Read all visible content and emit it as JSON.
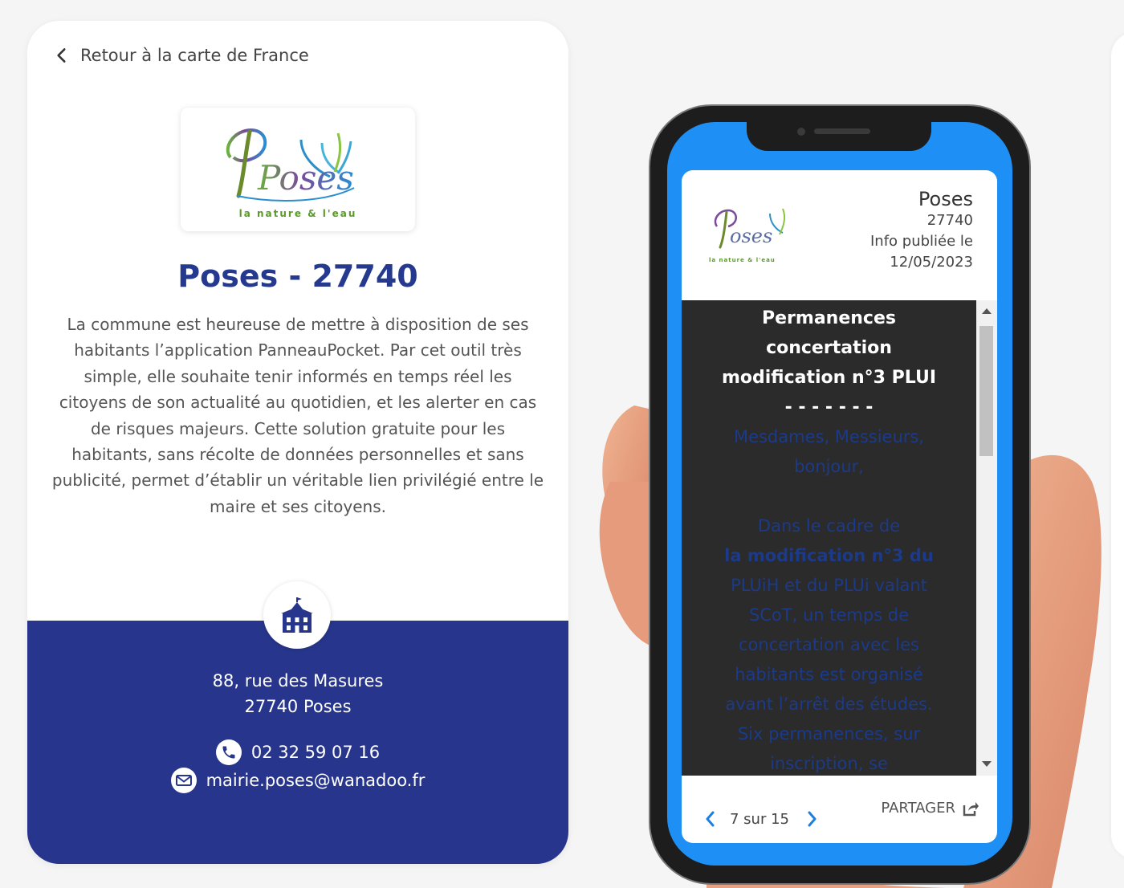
{
  "left_card": {
    "back_link": "Retour à la carte de France",
    "logo": {
      "word": "Poses",
      "tagline": "la nature & l'eau"
    },
    "title": "Poses - 27740",
    "description": "La commune est heureuse de mettre à disposition de ses habitants l’application PanneauPocket. Par cet outil très simple, elle souhaite tenir informés en temps réel les citoyens de son actualité au quotidien, et les alerter en cas de risques majeurs. Cette solution gratuite pour les habitants, sans récolte de données personnelles et sans publicité, permet d’établir un véritable lien privilégié entre le maire et ses citoyens.",
    "address_line1": "88, rue des Masures",
    "address_line2": "27740 Poses",
    "phone": "02 32 59 07 16",
    "email": "mairie.poses@wanadoo.fr"
  },
  "phone_app": {
    "city": "Poses",
    "postcode": "27740",
    "published_label": "Info publiée le",
    "published_date": "12/05/2023",
    "message_title_lines": [
      "Permanences",
      "concertation",
      "modification n°3 PLUI",
      "- - - - - - -"
    ],
    "message_body_lines": [
      "Mesdames, Messieurs,",
      "bonjour,",
      "",
      "Dans le cadre de",
      "la modification n°3 du",
      "PLUiH et du PLUi valant",
      "SCoT, un temps de",
      "concertation avec les",
      "habitants est organisé",
      "avant l’arrêt des études.",
      "Six permanences, sur",
      "inscription, se"
    ],
    "pager_text": "7 sur 15",
    "share_label": "PARTAGER"
  },
  "colors": {
    "title_blue": "#253a8e",
    "band_blue": "#27368c",
    "screen_blue": "#1e90f5",
    "message_bg": "#2b2b2b"
  },
  "icons": [
    "chevron-left-icon",
    "town-hall-icon",
    "phone-icon",
    "mail-icon",
    "share-icon",
    "chevron-right-icon"
  ]
}
